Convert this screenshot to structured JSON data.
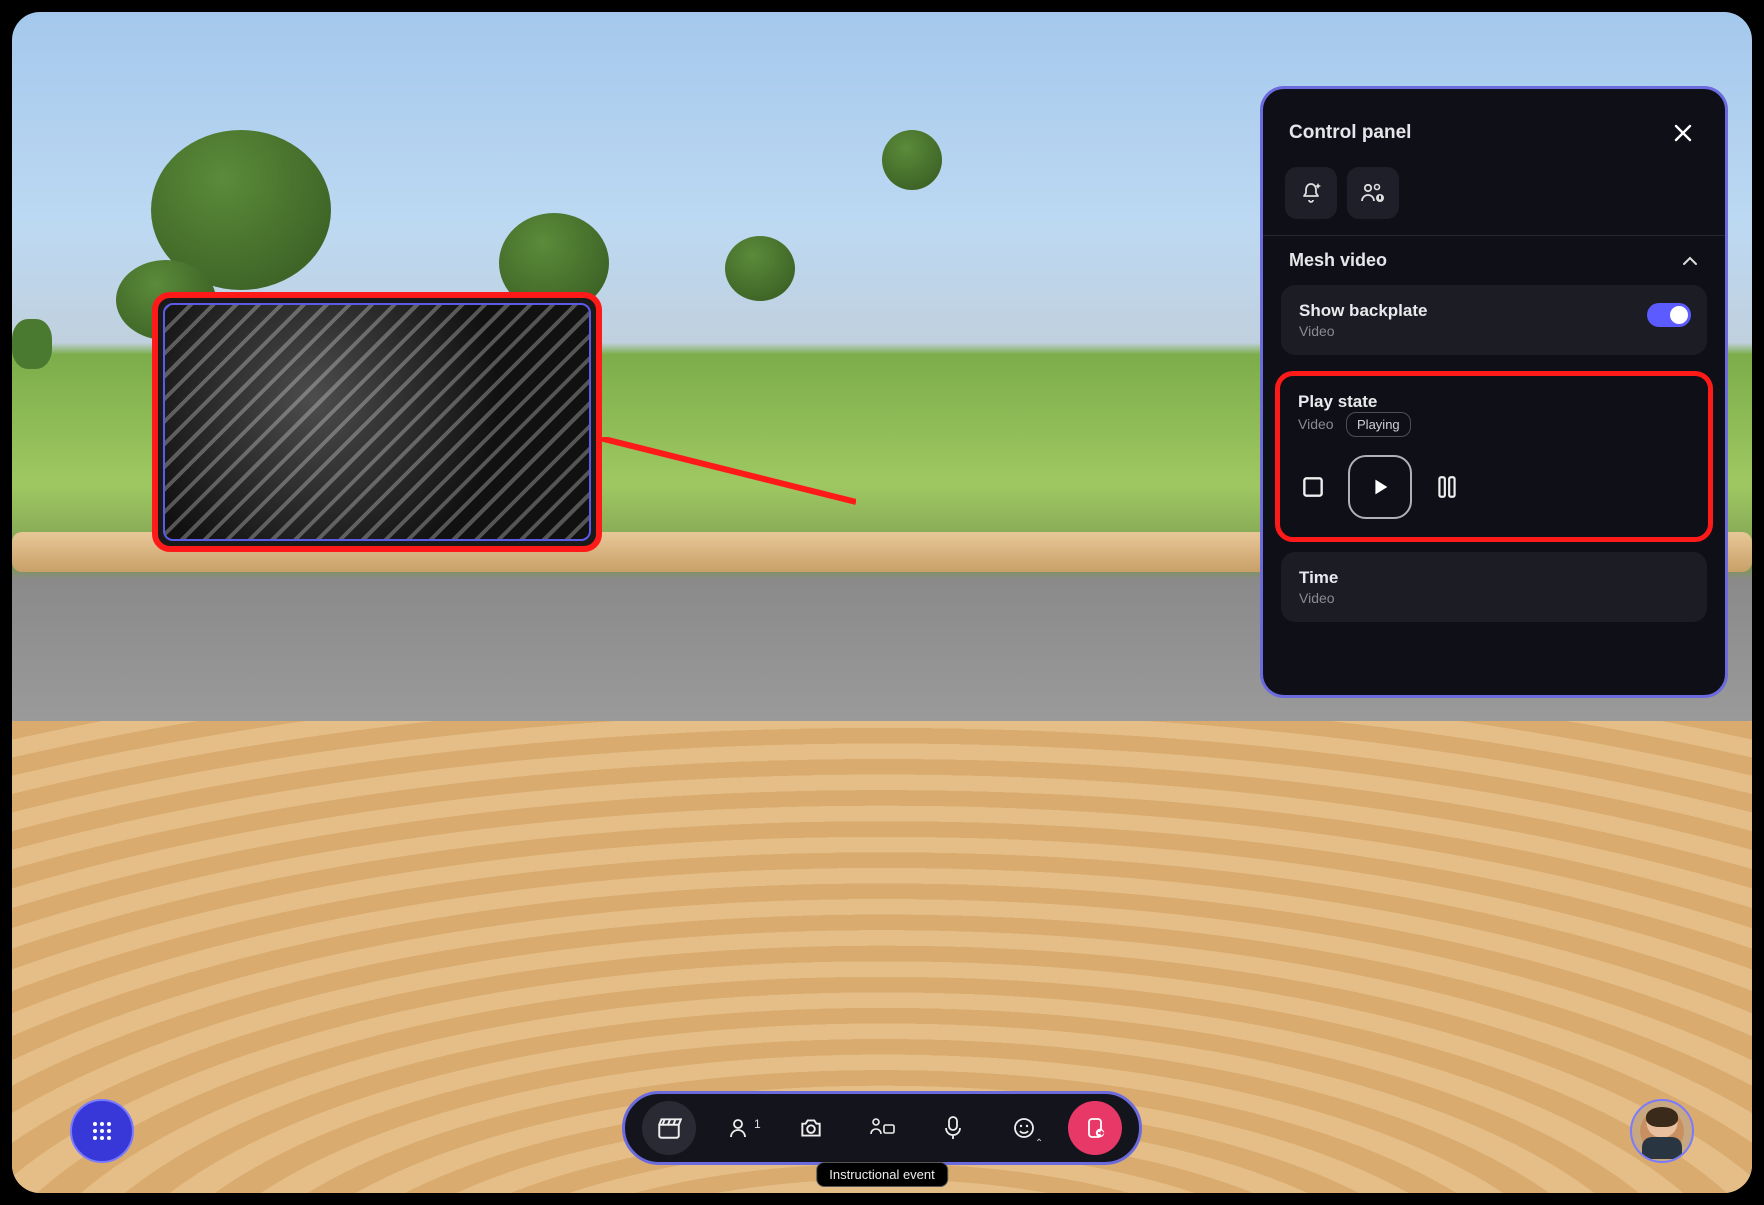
{
  "panel": {
    "title": "Control panel",
    "section_title": "Mesh video",
    "show_backplate": {
      "label": "Show backplate",
      "sub": "Video",
      "on": true
    },
    "play_state": {
      "label": "Play state",
      "sub": "Video",
      "badge": "Playing"
    },
    "time": {
      "label": "Time",
      "sub": "Video"
    }
  },
  "toolbar": {
    "participants_count": "1"
  },
  "event_badge": "Instructional event"
}
